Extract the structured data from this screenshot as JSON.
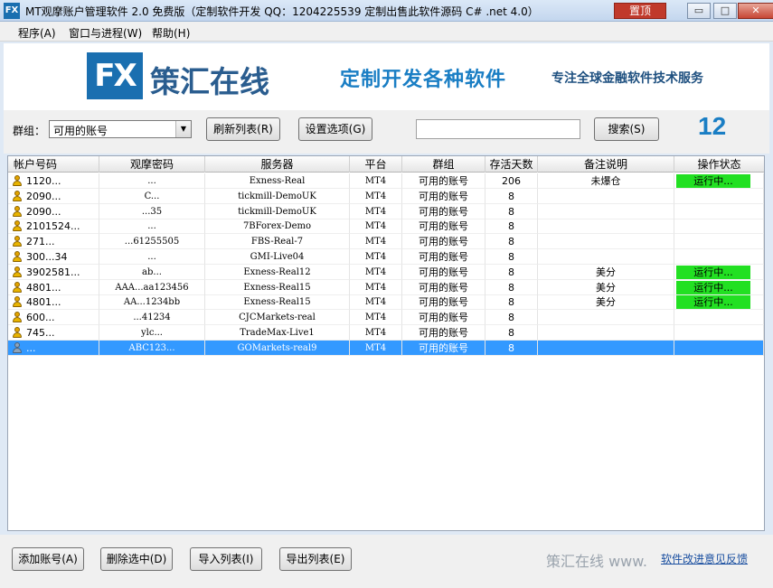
{
  "window": {
    "icon_text": "FX",
    "title": "MT观摩账户管理软件 2.0 免费版（定制软件开发 QQ：1204225539   定制出售此软件源码 C# .net 4.0）",
    "pin_label": "置顶",
    "minimize": "▭",
    "maximize": "□",
    "close": "✕"
  },
  "menu": [
    "程序(A)",
    "窗口与进程(W)",
    "帮助(H)"
  ],
  "banner": {
    "logo_text": "FX",
    "brand": "策汇在线",
    "slogan_main": "定制开发各种软件",
    "slogan_sub": "专注全球金融软件技术服务"
  },
  "toolbar": {
    "group_label": "群组：",
    "group_selected": "可用的账号",
    "refresh_button": "刷新列表(R)",
    "settings_button": "设置选项(G)",
    "search_value": "",
    "search_button": "搜索(S)",
    "count": "12"
  },
  "grid": {
    "columns": [
      "帐户号码",
      "观摩密码",
      "服务器",
      "平台",
      "群组",
      "存活天数",
      "备注说明",
      "操作状态"
    ],
    "rows": [
      {
        "account": "1120...",
        "password": "...",
        "server": "Exness-Real",
        "platform": "MT4",
        "group": "可用的账号",
        "days": "206",
        "note": "未爆仓",
        "status": "运行中..."
      },
      {
        "account": "2090...",
        "password": "C...",
        "server": "tickmill-DemoUK",
        "platform": "MT4",
        "group": "可用的账号",
        "days": "8",
        "note": "",
        "status": ""
      },
      {
        "account": "2090...",
        "password": "...35",
        "server": "tickmill-DemoUK",
        "platform": "MT4",
        "group": "可用的账号",
        "days": "8",
        "note": "",
        "status": ""
      },
      {
        "account": "2101524...",
        "password": "...",
        "server": "7BForex-Demo",
        "platform": "MT4",
        "group": "可用的账号",
        "days": "8",
        "note": "",
        "status": ""
      },
      {
        "account": "271...",
        "password": "...61255505",
        "server": "FBS-Real-7",
        "platform": "MT4",
        "group": "可用的账号",
        "days": "8",
        "note": "",
        "status": ""
      },
      {
        "account": "300...34",
        "password": "...",
        "server": "GMI-Live04",
        "platform": "MT4",
        "group": "可用的账号",
        "days": "8",
        "note": "",
        "status": ""
      },
      {
        "account": "3902581...",
        "password": "ab...",
        "server": "Exness-Real12",
        "platform": "MT4",
        "group": "可用的账号",
        "days": "8",
        "note": "美分",
        "status": "运行中..."
      },
      {
        "account": "4801...",
        "password": "AAA...aa123456",
        "server": "Exness-Real15",
        "platform": "MT4",
        "group": "可用的账号",
        "days": "8",
        "note": "美分",
        "status": "运行中..."
      },
      {
        "account": "4801...",
        "password": "AA...1234bb",
        "server": "Exness-Real15",
        "platform": "MT4",
        "group": "可用的账号",
        "days": "8",
        "note": "美分",
        "status": "运行中..."
      },
      {
        "account": "600...",
        "password": "...41234",
        "server": "CJCMarkets-real",
        "platform": "MT4",
        "group": "可用的账号",
        "days": "8",
        "note": "",
        "status": ""
      },
      {
        "account": "745...",
        "password": "ylc...",
        "server": "TradeMax-Live1",
        "platform": "MT4",
        "group": "可用的账号",
        "days": "8",
        "note": "",
        "status": ""
      },
      {
        "account": "...",
        "password": "ABC123...",
        "server": "GOMarkets-real9",
        "platform": "MT4",
        "group": "可用的账号",
        "days": "8",
        "note": "",
        "status": ""
      }
    ]
  },
  "bottom": {
    "add_button": "添加账号(A)",
    "delete_button": "删除选中(D)",
    "import_button": "导入列表(I)",
    "export_button": "导出列表(E)",
    "watermark": "策汇在线 www.",
    "feedback_link": "软件改进意见反馈"
  },
  "colors": {
    "accent": "#1a7ec4",
    "selected_row": "#3399ff",
    "status_running": "#22e022",
    "pin_button": "#c0392b"
  }
}
